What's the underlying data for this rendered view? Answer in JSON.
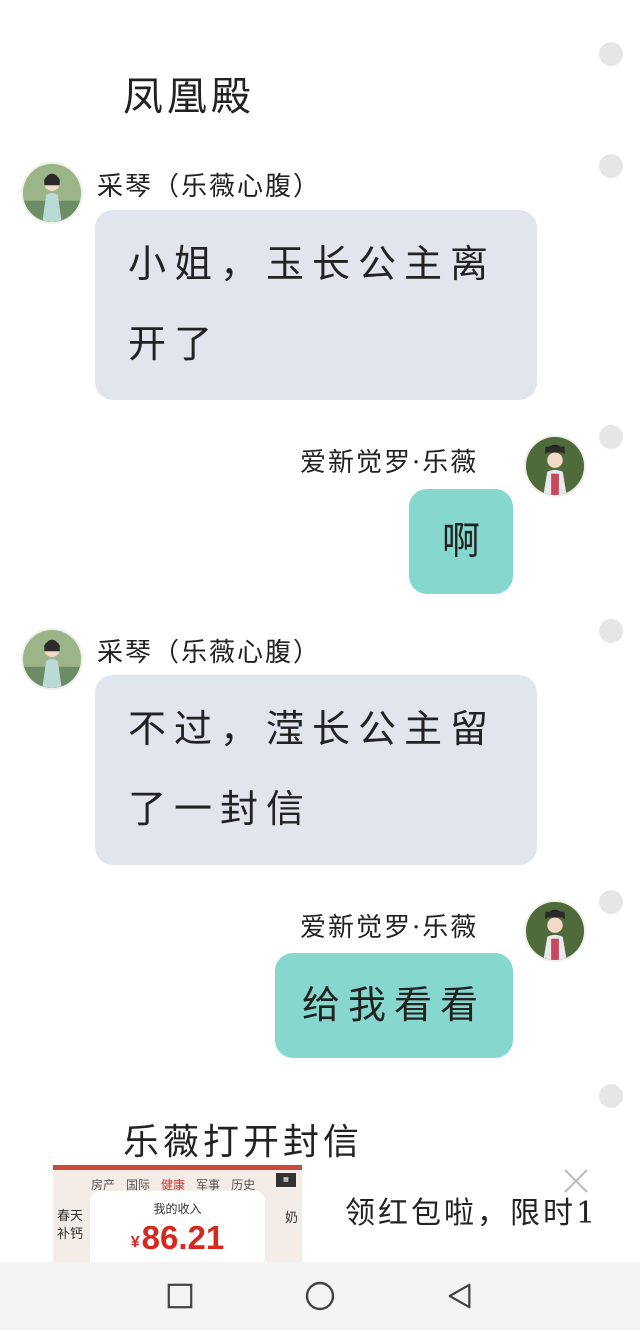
{
  "scene_title": "凤凰殿",
  "messages": [
    {
      "speaker": "采琴（乐薇心腹）",
      "text_line1": "小姐，玉长公主离",
      "text_line2": "开了"
    },
    {
      "speaker": "爱新觉罗·乐薇",
      "text": "啊"
    },
    {
      "speaker": "采琴（乐薇心腹）",
      "text_line1": "不过，滢长公主留",
      "text_line2": "了一封信"
    },
    {
      "speaker": "爱新觉罗·乐薇",
      "text": "给我看看"
    }
  ],
  "narration": "乐薇打开封信",
  "ad": {
    "tabs": [
      "房产",
      "国际",
      "健康",
      "军事",
      "历史"
    ],
    "side_left": "春天补钙",
    "side_right": "奶",
    "card_label": "我的收入",
    "currency": "¥",
    "amount": "86.21",
    "text": "领红包啦，限时1",
    "close_icon": "close-icon"
  },
  "nav": {
    "recent_icon": "square-recent-apps-icon",
    "home_icon": "circle-home-icon",
    "back_icon": "triangle-back-icon"
  },
  "colors": {
    "left_bubble": "#e0e5ee",
    "right_bubble": "#86d8cf"
  }
}
